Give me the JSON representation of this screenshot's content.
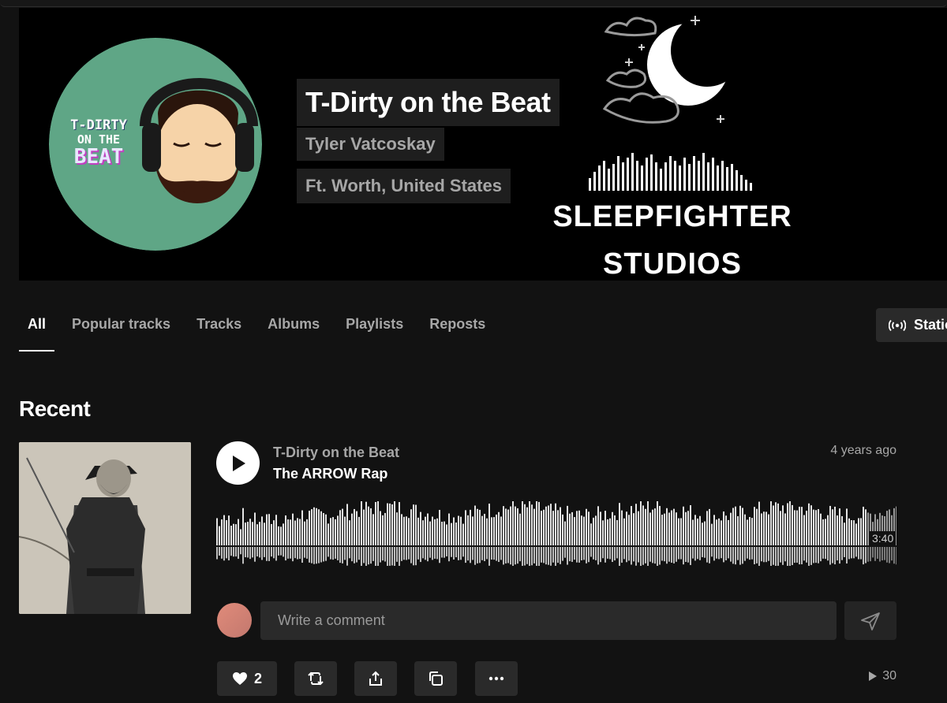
{
  "profile": {
    "artist_name": "T-Dirty on the Beat",
    "real_name": "Tyler Vatcoskay",
    "location": "Ft. Worth, United States",
    "avatar_text_line1": "T-DIRTY",
    "avatar_text_line2": "ON THE",
    "avatar_text_line3": "BEAT",
    "banner_logo_line1": "SLEEPFIGHTER",
    "banner_logo_line2": "STUDIOS"
  },
  "tabs": [
    {
      "label": "All",
      "active": true
    },
    {
      "label": "Popular tracks"
    },
    {
      "label": "Tracks"
    },
    {
      "label": "Albums"
    },
    {
      "label": "Playlists"
    },
    {
      "label": "Reposts"
    }
  ],
  "station_label": "Station",
  "recent": {
    "title": "Recent",
    "track": {
      "artist": "T-Dirty on the Beat",
      "title": "The ARROW Rap",
      "age": "4 years ago",
      "duration": "3:40",
      "likes": "2",
      "plays": "30"
    }
  },
  "comment": {
    "placeholder": "Write a comment"
  },
  "icons": {
    "play": "play-icon",
    "like": "heart-icon",
    "repost": "repost-icon",
    "share": "share-icon",
    "copy": "copy-icon",
    "more": "more-icon",
    "send": "send-icon",
    "station": "broadcast-icon",
    "plays": "play-count-icon"
  },
  "colors": {
    "background": "#121212",
    "avatar_bg": "#5fa686",
    "chip_bg": "#1e1e1e",
    "secondary_text": "#a7a7a7"
  }
}
